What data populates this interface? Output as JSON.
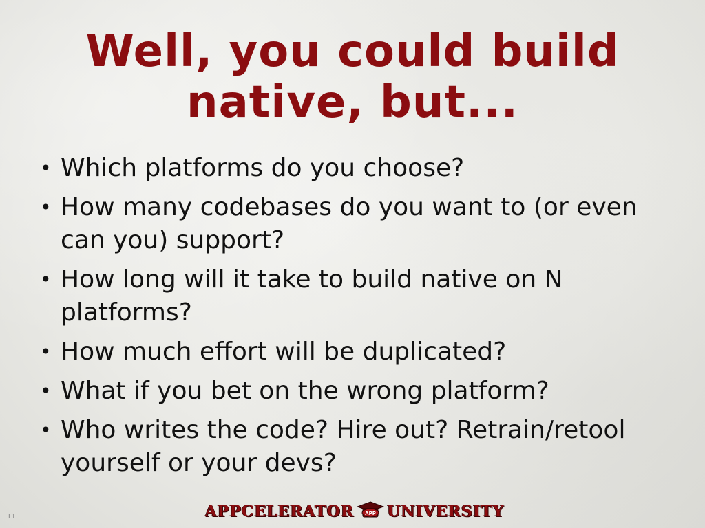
{
  "slide": {
    "title_lines": [
      "Well, you could build",
      "native, but..."
    ],
    "bullets": [
      "Which platforms do you choose?",
      "How many codebases do you want to (or even can you) support?",
      "How long will it take to build native on N platforms?",
      "How much effort will be duplicated?",
      "What if you bet on the wrong platform?",
      "Who writes the code?  Hire out?  Retrain/retool yourself or your devs?"
    ],
    "bullet_glyph": "•",
    "page_number": "11"
  },
  "footer": {
    "logo_left": "APPCELERATOR",
    "logo_badge": "APP",
    "logo_right": "UNIVERSITY"
  },
  "colors": {
    "title": "#8b0d10",
    "text": "#111111",
    "logo": "#8b0d10"
  }
}
